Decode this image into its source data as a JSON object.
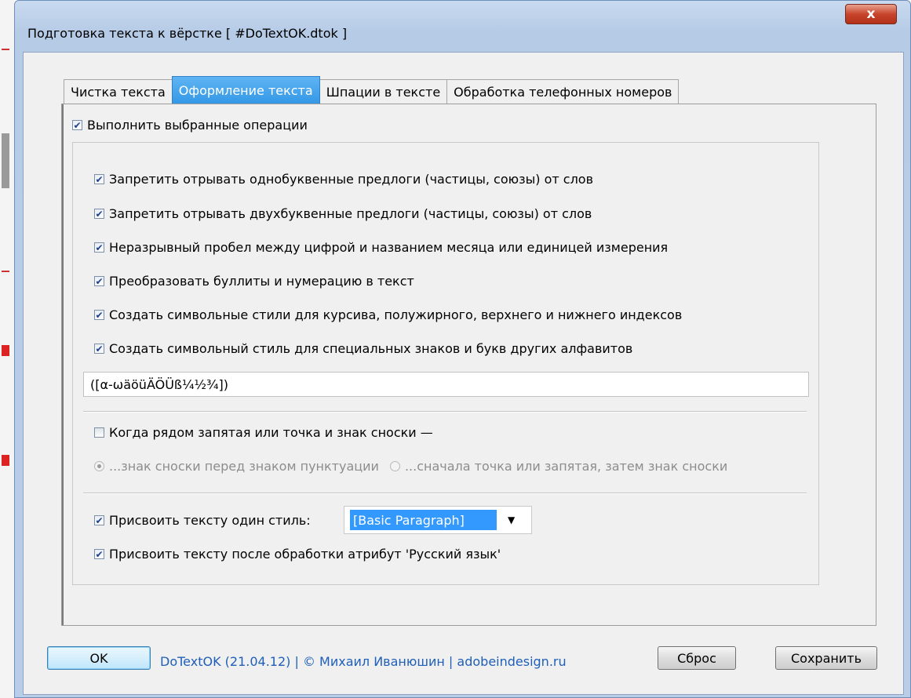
{
  "window": {
    "title": "Подготовка текста к вёрстке  [ #DoTextOK.dtok ]",
    "close_label": "x"
  },
  "tabs": [
    {
      "label": "Чистка текста",
      "active": false
    },
    {
      "label": "Оформление текста",
      "active": true
    },
    {
      "label": "Шпации в тексте",
      "active": false
    },
    {
      "label": "Обработка телефонных номеров",
      "active": false
    }
  ],
  "panel": {
    "execute": {
      "label": "Выполнить выбранные операции",
      "checked": true
    },
    "options": [
      {
        "label": "Запретить отрывать однобуквенные предлоги (частицы, союзы) от слов",
        "checked": true
      },
      {
        "label": "Запретить отрывать двухбуквенные предлоги (частицы, союзы) от слов",
        "checked": true
      },
      {
        "label": "Неразрывный пробел между цифрой и названием месяца или единицей измерения",
        "checked": true
      },
      {
        "label": "Преобразовать буллиты и нумерацию в текст",
        "checked": true
      },
      {
        "label": "Создать символьные стили для курсива, полужирного, верхнего и нижнего индексов",
        "checked": true
      },
      {
        "label": "Создать символьный стиль для специальных знаков и букв других алфавитов",
        "checked": true
      }
    ],
    "regex_value": "([α-ωäöüÄÖÜß¼½¾])",
    "footnote": {
      "label": "Когда рядом запятая или точка и знак сноски —",
      "checked": false,
      "radio_before": "...знак сноски перед знаком пунктуации",
      "radio_after": "...сначала точка или запятая, затем знак сноски"
    },
    "style": {
      "label": "Присвоить тексту один стиль:",
      "checked": true,
      "selected": "[Basic Paragraph]"
    },
    "lang": {
      "label": "Присвоить тексту после обработки атрибут 'Русский язык'",
      "checked": true
    }
  },
  "footer": {
    "ok_label": "OK",
    "credits": "DoTextOK (21.04.12) | © Михаил Иванюшин | adobeindesign.ru",
    "reset_label": "Сброс",
    "save_label": "Сохранить"
  }
}
